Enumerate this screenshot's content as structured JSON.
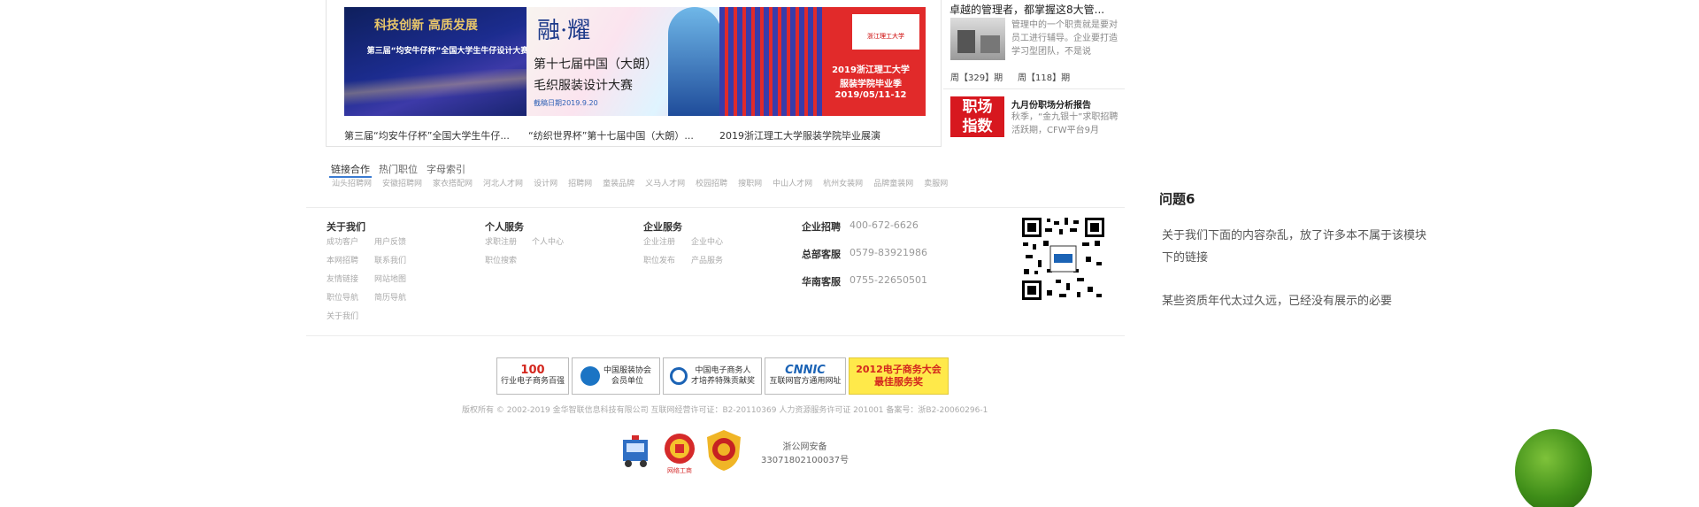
{
  "showcase": {
    "items": [
      {
        "caption": "第三届“均安牛仔杯”全国大学生牛仔...",
        "img_text": [
          "科技创新  高质发展",
          "第三届“均安牛仔杯”全国大学生牛仔设计大赛"
        ]
      },
      {
        "caption": "“纺织世界杯”第十七届中国（大朗）...",
        "img_text": [
          "融·耀",
          "第十七届中国（大朗）",
          "毛织服装设计大赛",
          "截稿日期2019.9.20"
        ]
      },
      {
        "caption": "2019浙江理工大学服装学院毕业展演",
        "img_text": [
          "浙江理工大学",
          "2019浙江理工大学",
          "服装学院毕业季",
          "2019/05/11-12"
        ]
      }
    ]
  },
  "sidebar": {
    "title": "卓越的管理者，都掌握这8大管...",
    "desc": "管理中的一个职责就是要对员工进行辅导。企业要打造学习型团队，不是说",
    "issues": [
      "周【329】期",
      "周【118】期"
    ],
    "report_logo": [
      "职场",
      "指数"
    ],
    "report_title": "九月份职场分析报告",
    "report_desc": "秋季，“金九银十”求职招聘活跃期，CFW平台9月"
  },
  "tabs": [
    "链接合作",
    "热门职位",
    "字母索引"
  ],
  "links": [
    "汕头招聘网",
    "安徽招聘网",
    "家衣搭配网",
    "河北人才网",
    "设计网",
    "招聘网",
    "童装品牌",
    "义马人才网",
    "校园招聘",
    "搜职网",
    "中山人才网",
    "杭州女装网",
    "品牌童装网",
    "卖服网"
  ],
  "footer": {
    "cols": [
      {
        "title": "关于我们",
        "links": [
          "成功客户",
          "用户反馈",
          "本网招聘",
          "联系我们",
          "友情链接",
          "网站地图",
          "职位导航",
          "简历导航",
          "关于我们"
        ]
      },
      {
        "title": "个人服务",
        "links": [
          "求职注册",
          "个人中心",
          "职位搜索"
        ]
      },
      {
        "title": "企业服务",
        "links": [
          "企业注册",
          "企业中心",
          "职位发布",
          "产品服务"
        ]
      }
    ],
    "phones": [
      {
        "label": "企业招聘",
        "number": "400-672-6626"
      },
      {
        "label": "总部客服",
        "number": "0579-83921986"
      },
      {
        "label": "华南客服",
        "number": "0755-22650501"
      }
    ]
  },
  "question": {
    "title": "问题6",
    "text1": "关于我们下面的内容杂乱，放了许多本不属于该模块下的链接",
    "text2": "某些资质年代太过久远，已经没有展示的必要"
  },
  "badges": [
    {
      "line1": "100",
      "line2": "行业电子商务百强"
    },
    {
      "line1": "中国服装协会",
      "line2": "会员单位"
    },
    {
      "line1": "中国电子商务人",
      "line2": "才培养特殊贡献奖"
    },
    {
      "line1": "CNNIC",
      "line2": "互联网官方通用网址"
    },
    {
      "line1": "2012电子商务大会",
      "line2": "最佳服务奖"
    }
  ],
  "copyright": "版权所有 © 2002-2019 金华智联信息科技有限公司 互联网经营许可证：B2-20110369 人力资源服务许可证 201001 备案号：浙B2-20060296-1",
  "police": {
    "line1": "浙公网安备",
    "line2": "33071802100037号",
    "stamp": "网络工商"
  }
}
